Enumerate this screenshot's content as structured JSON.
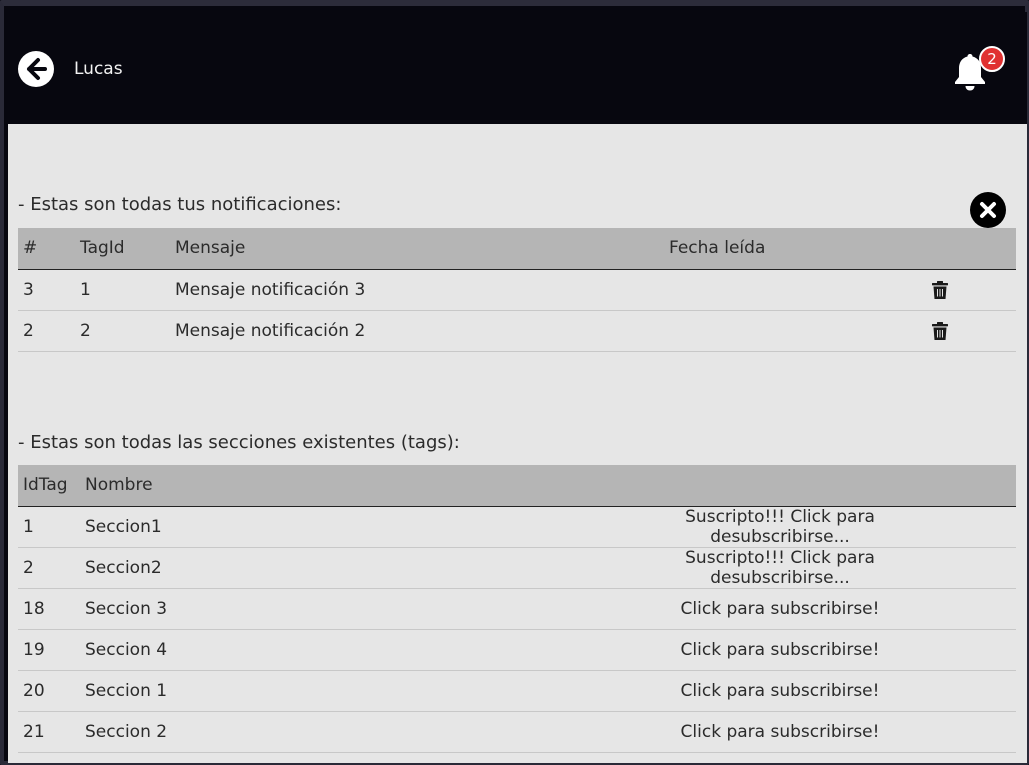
{
  "header": {
    "user_name": "Lucas",
    "notification_count": "2"
  },
  "notifications": {
    "title": "- Estas son todas tus notificaciones:",
    "columns": [
      "#",
      "TagId",
      "Mensaje",
      "Fecha leída"
    ],
    "rows": [
      {
        "id": "3",
        "tag_id": "1",
        "message": "Mensaje notificación 3",
        "read_date": ""
      },
      {
        "id": "2",
        "tag_id": "2",
        "message": "Mensaje notificación 2",
        "read_date": ""
      }
    ]
  },
  "tags": {
    "title": "- Estas son todas las secciones existentes (tags):",
    "columns": [
      "IdTag",
      "Nombre"
    ],
    "rows": [
      {
        "id": "1",
        "name": "Seccion1",
        "action": "Suscripto!!! Click para desubscribirse..."
      },
      {
        "id": "2",
        "name": "Seccion2",
        "action": "Suscripto!!! Click para desubscribirse..."
      },
      {
        "id": "18",
        "name": "Seccion 3",
        "action": "Click para subscribirse!"
      },
      {
        "id": "19",
        "name": "Seccion 4",
        "action": "Click para subscribirse!"
      },
      {
        "id": "20",
        "name": "Seccion 1",
        "action": "Click para subscribirse!"
      },
      {
        "id": "21",
        "name": "Seccion 2",
        "action": "Click para subscribirse!"
      }
    ]
  },
  "icons": {
    "back": "arrow-left-circle-icon",
    "bell": "bell-icon",
    "close": "close-circle-icon",
    "delete": "trash-icon"
  },
  "colors": {
    "topbar": "#07070f",
    "content": "#e6e6e6",
    "table_header": "#b5b5b5",
    "badge": "#e03131"
  }
}
